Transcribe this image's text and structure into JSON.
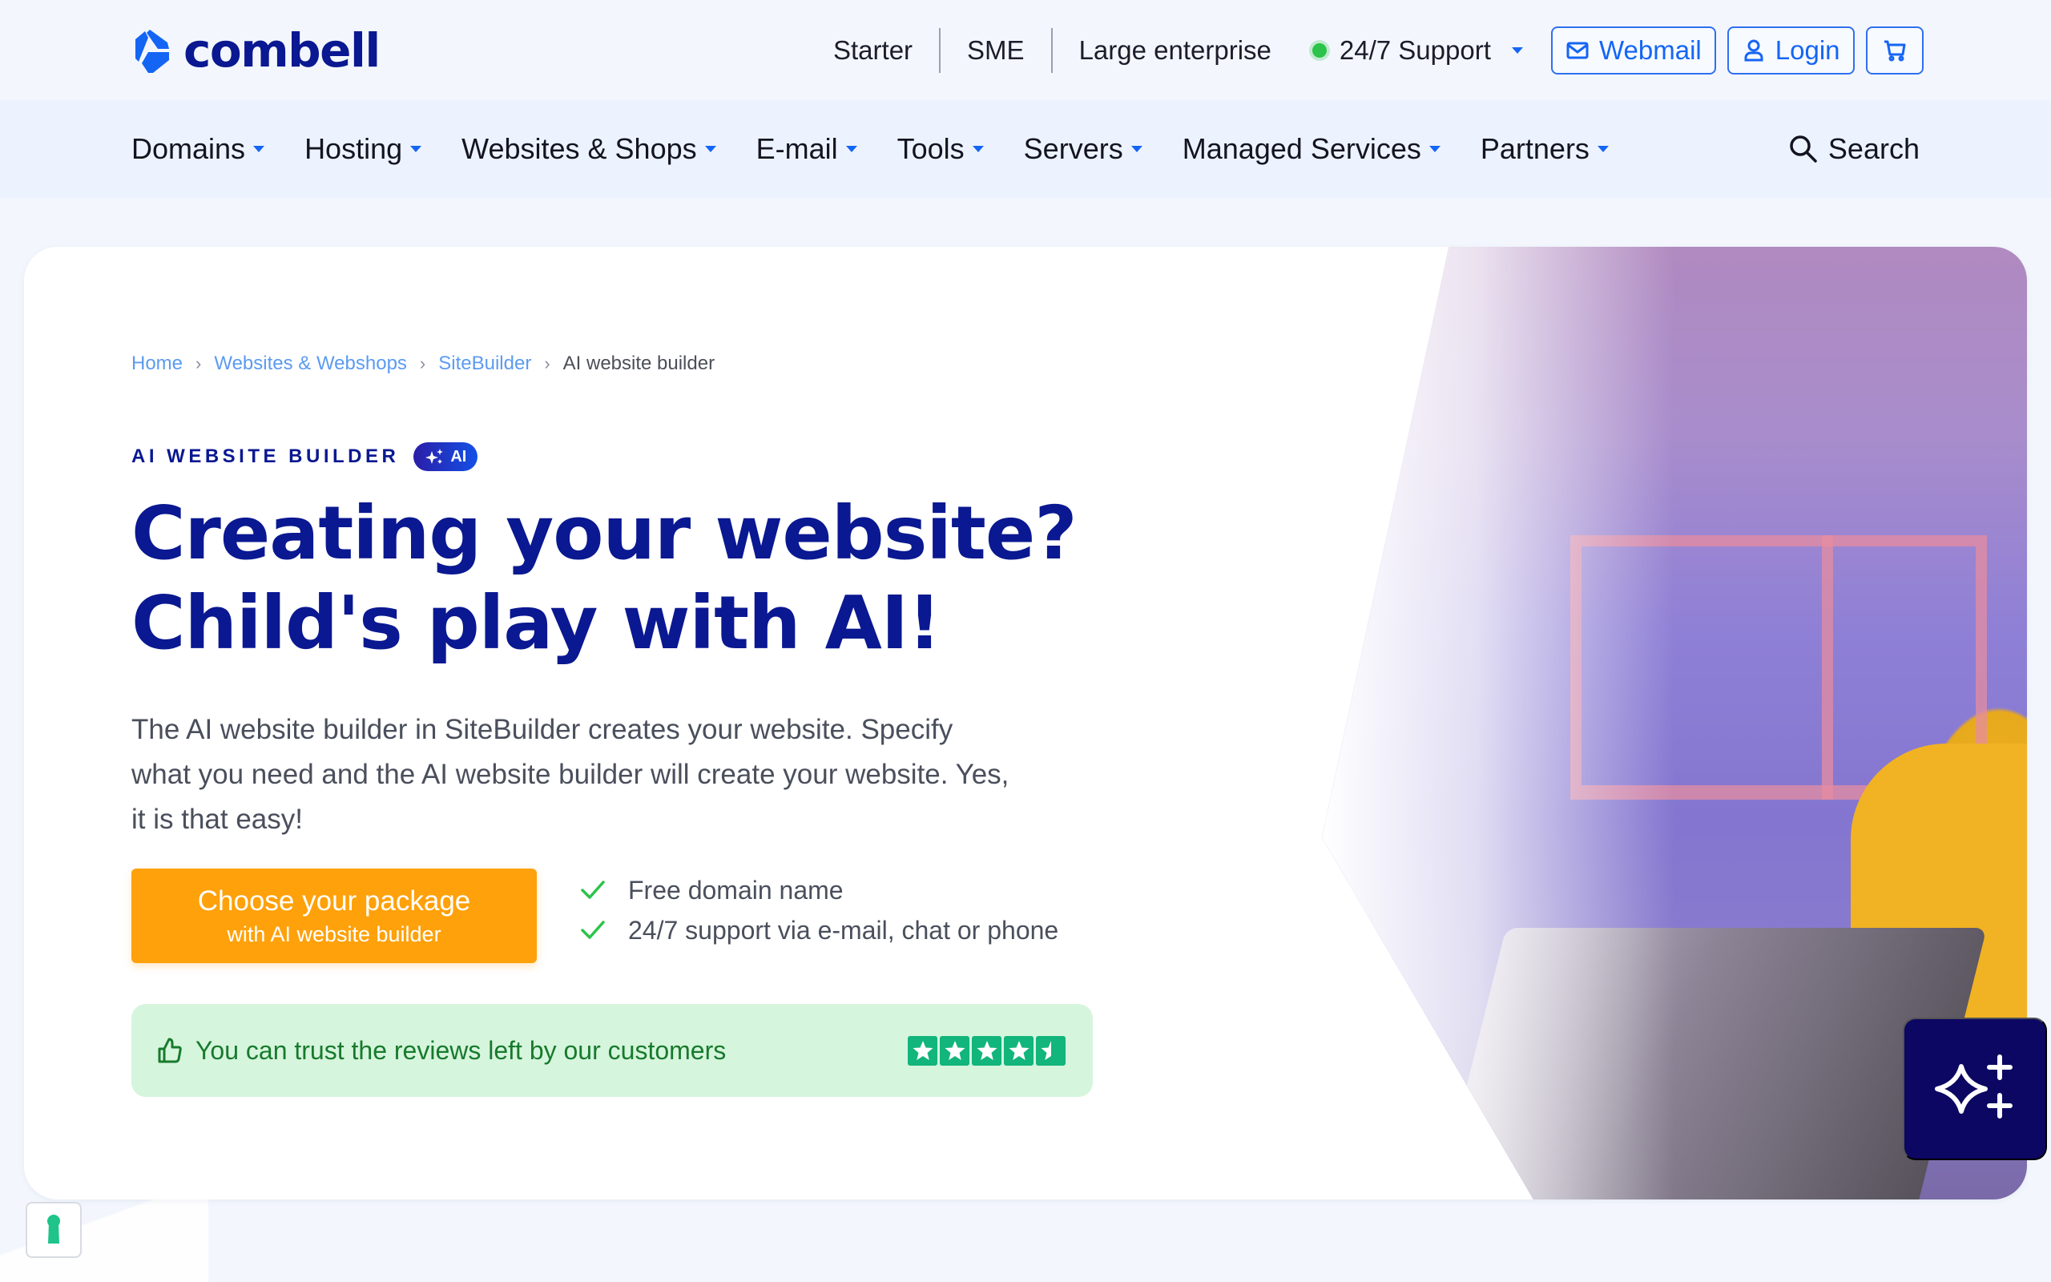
{
  "brand": {
    "name": "combell",
    "logo_color": "#1565f5",
    "wordmark_color": "#0a1891"
  },
  "utility_nav": {
    "links": [
      "Starter",
      "SME",
      "Large enterprise"
    ],
    "support": {
      "label": "24/7 Support",
      "status": "online",
      "status_color": "#2cc34a"
    },
    "buttons": {
      "webmail": {
        "label": "Webmail",
        "icon": "envelope-icon"
      },
      "login": {
        "label": "Login",
        "icon": "user-icon"
      },
      "cart": {
        "icon": "shopping-cart-icon"
      }
    }
  },
  "main_nav": {
    "items": [
      {
        "label": "Domains",
        "has_dropdown": true
      },
      {
        "label": "Hosting",
        "has_dropdown": true
      },
      {
        "label": "Websites & Shops",
        "has_dropdown": true
      },
      {
        "label": "E-mail",
        "has_dropdown": true
      },
      {
        "label": "Tools",
        "has_dropdown": true
      },
      {
        "label": "Servers",
        "has_dropdown": true
      },
      {
        "label": "Managed Services",
        "has_dropdown": true
      },
      {
        "label": "Partners",
        "has_dropdown": true
      }
    ],
    "search_label": "Search"
  },
  "hero": {
    "breadcrumb": {
      "links": [
        "Home",
        "Websites & Webshops",
        "SiteBuilder"
      ],
      "current": "AI website builder",
      "separator": "›"
    },
    "eyebrow": "AI WEBSITE BUILDER",
    "badge": "AI",
    "headline_line1": "Creating your website?",
    "headline_line2": "Child's play with AI!",
    "lead": "The AI website builder in SiteBuilder creates your website. Specify what you need and the AI website builder will create your website. Yes, it is that easy!",
    "cta": {
      "main": "Choose your package",
      "sub": "with AI website builder",
      "color": "#ffa10a"
    },
    "usps": [
      "Free domain name",
      "24/7 support via e-mail, chat or phone"
    ],
    "trust": {
      "text": "You can trust the reviews left by our customers",
      "rating": 4.5,
      "rating_max": 5,
      "star_color": "#12b57b"
    }
  },
  "floating": {
    "ai_assistant_icon": "sparkles-icon",
    "privacy_icon": "keyhole-icon"
  }
}
